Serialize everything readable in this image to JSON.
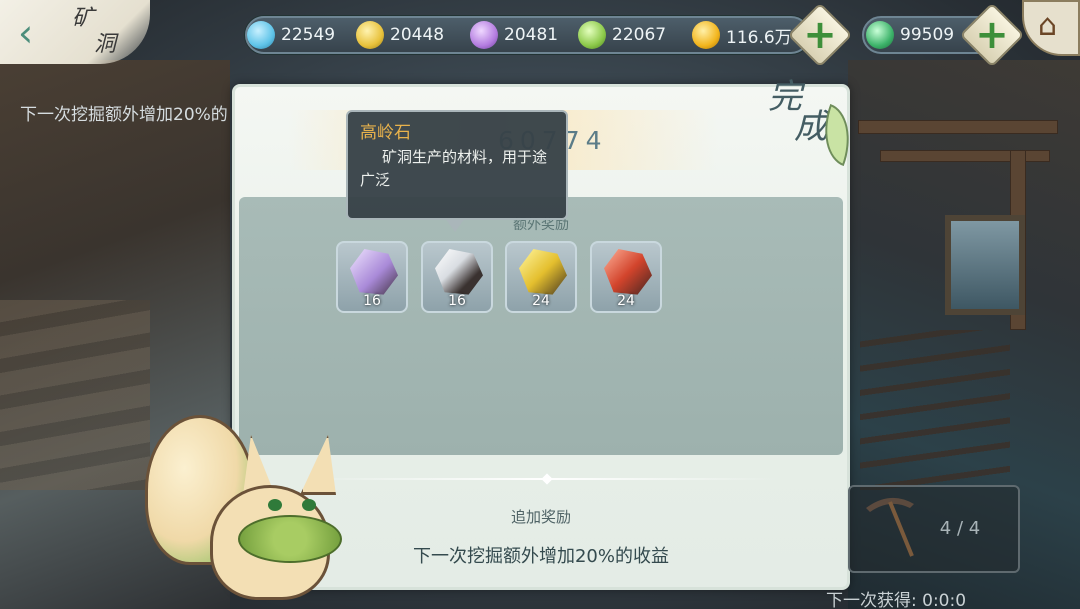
{
  "header": {
    "title_line1": "矿",
    "title_line2": "洞",
    "back_icon": "chevron-left-icon",
    "home_icon": "house-icon"
  },
  "resources": [
    {
      "name": "blue-crystal",
      "value": "22549",
      "color": "#5fc4e8"
    },
    {
      "name": "gold-crystal",
      "value": "20448",
      "color": "#e8c23c"
    },
    {
      "name": "purple-crystal",
      "value": "20481",
      "color": "#b47de0"
    },
    {
      "name": "green-crystal",
      "value": "22067",
      "color": "#8cc94a"
    },
    {
      "name": "gold-coin",
      "value": "116.6万",
      "color": "#f2b51d"
    },
    {
      "name": "jade",
      "value": "99509",
      "color": "#3db36a"
    }
  ],
  "background": {
    "left_text": "下一次挖掘额外增加20%的"
  },
  "panel": {
    "score_value": "60774",
    "complete_line1": "完",
    "complete_line2": "成",
    "rewards_title": "额外奖励",
    "items": [
      {
        "name": "purple-ore",
        "qty": "16",
        "color": "#a98ad8"
      },
      {
        "name": "kaolin-stone",
        "qty": "16",
        "color": "#d9dde2"
      },
      {
        "name": "gold-ore",
        "qty": "24",
        "color": "#e4bf2e"
      },
      {
        "name": "red-ore",
        "qty": "24",
        "color": "#d2442c"
      }
    ],
    "bonus_title": "追加奖励",
    "bonus_desc": "下一次挖掘额外增加20%的收益"
  },
  "tooltip": {
    "name": "高岭石",
    "desc": "矿洞生产的材料，用于途广泛"
  },
  "mine": {
    "count": "4 / 4",
    "next_gain": "下一次获得:    0:0:0"
  }
}
